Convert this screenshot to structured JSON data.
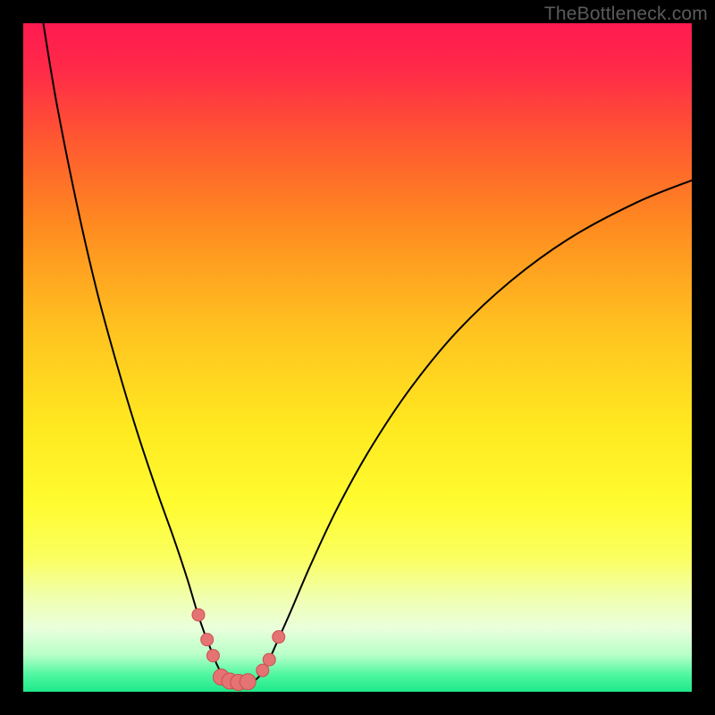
{
  "watermark": "TheBottleneck.com",
  "chart_data": {
    "type": "line",
    "title": "",
    "xlabel": "",
    "ylabel": "",
    "xlim": [
      0,
      100
    ],
    "ylim": [
      0,
      100
    ],
    "background_gradient": {
      "stops": [
        {
          "offset": 0.0,
          "color": "#ff1a50"
        },
        {
          "offset": 0.07,
          "color": "#ff2a48"
        },
        {
          "offset": 0.18,
          "color": "#ff5a30"
        },
        {
          "offset": 0.3,
          "color": "#ff8a20"
        },
        {
          "offset": 0.45,
          "color": "#ffc020"
        },
        {
          "offset": 0.6,
          "color": "#ffe820"
        },
        {
          "offset": 0.72,
          "color": "#fffc30"
        },
        {
          "offset": 0.8,
          "color": "#fbff60"
        },
        {
          "offset": 0.86,
          "color": "#f0ffb0"
        },
        {
          "offset": 0.905,
          "color": "#eaffdc"
        },
        {
          "offset": 0.945,
          "color": "#b8ffc8"
        },
        {
          "offset": 0.975,
          "color": "#4df7a0"
        },
        {
          "offset": 1.0,
          "color": "#1fe88a"
        }
      ]
    },
    "series": [
      {
        "name": "curve",
        "color": "#000000",
        "width": 2,
        "x": [
          3.0,
          5.0,
          8.0,
          11.0,
          14.0,
          17.0,
          20.0,
          22.5,
          24.5,
          26.0,
          27.2,
          28.2,
          29.0,
          29.8,
          30.8,
          32.5,
          34.0,
          35.2,
          36.5,
          38.0,
          40.0,
          43.0,
          47.0,
          52.0,
          58.0,
          65.0,
          73.0,
          82.0,
          92.0,
          100.0
        ],
        "y": [
          100.0,
          88.0,
          73.0,
          60.0,
          49.0,
          39.0,
          30.0,
          23.0,
          17.0,
          12.0,
          8.5,
          6.0,
          4.0,
          2.6,
          1.8,
          1.4,
          1.4,
          2.2,
          4.2,
          7.5,
          12.0,
          19.0,
          27.5,
          36.5,
          45.5,
          54.0,
          61.5,
          68.0,
          73.3,
          76.5
        ]
      }
    ],
    "markers": {
      "color": "#e57373",
      "stroke": "#c94f4f",
      "radius_small": 7,
      "radius_large": 9,
      "points": [
        {
          "x": 26.2,
          "y": 11.5,
          "r": "small"
        },
        {
          "x": 27.5,
          "y": 7.8,
          "r": "small"
        },
        {
          "x": 28.4,
          "y": 5.4,
          "r": "small"
        },
        {
          "x": 29.6,
          "y": 2.2,
          "r": "large"
        },
        {
          "x": 30.9,
          "y": 1.6,
          "r": "large"
        },
        {
          "x": 32.2,
          "y": 1.4,
          "r": "large"
        },
        {
          "x": 33.6,
          "y": 1.5,
          "r": "large"
        },
        {
          "x": 35.8,
          "y": 3.2,
          "r": "small"
        },
        {
          "x": 36.8,
          "y": 4.8,
          "r": "small"
        },
        {
          "x": 38.2,
          "y": 8.2,
          "r": "small"
        }
      ]
    }
  }
}
